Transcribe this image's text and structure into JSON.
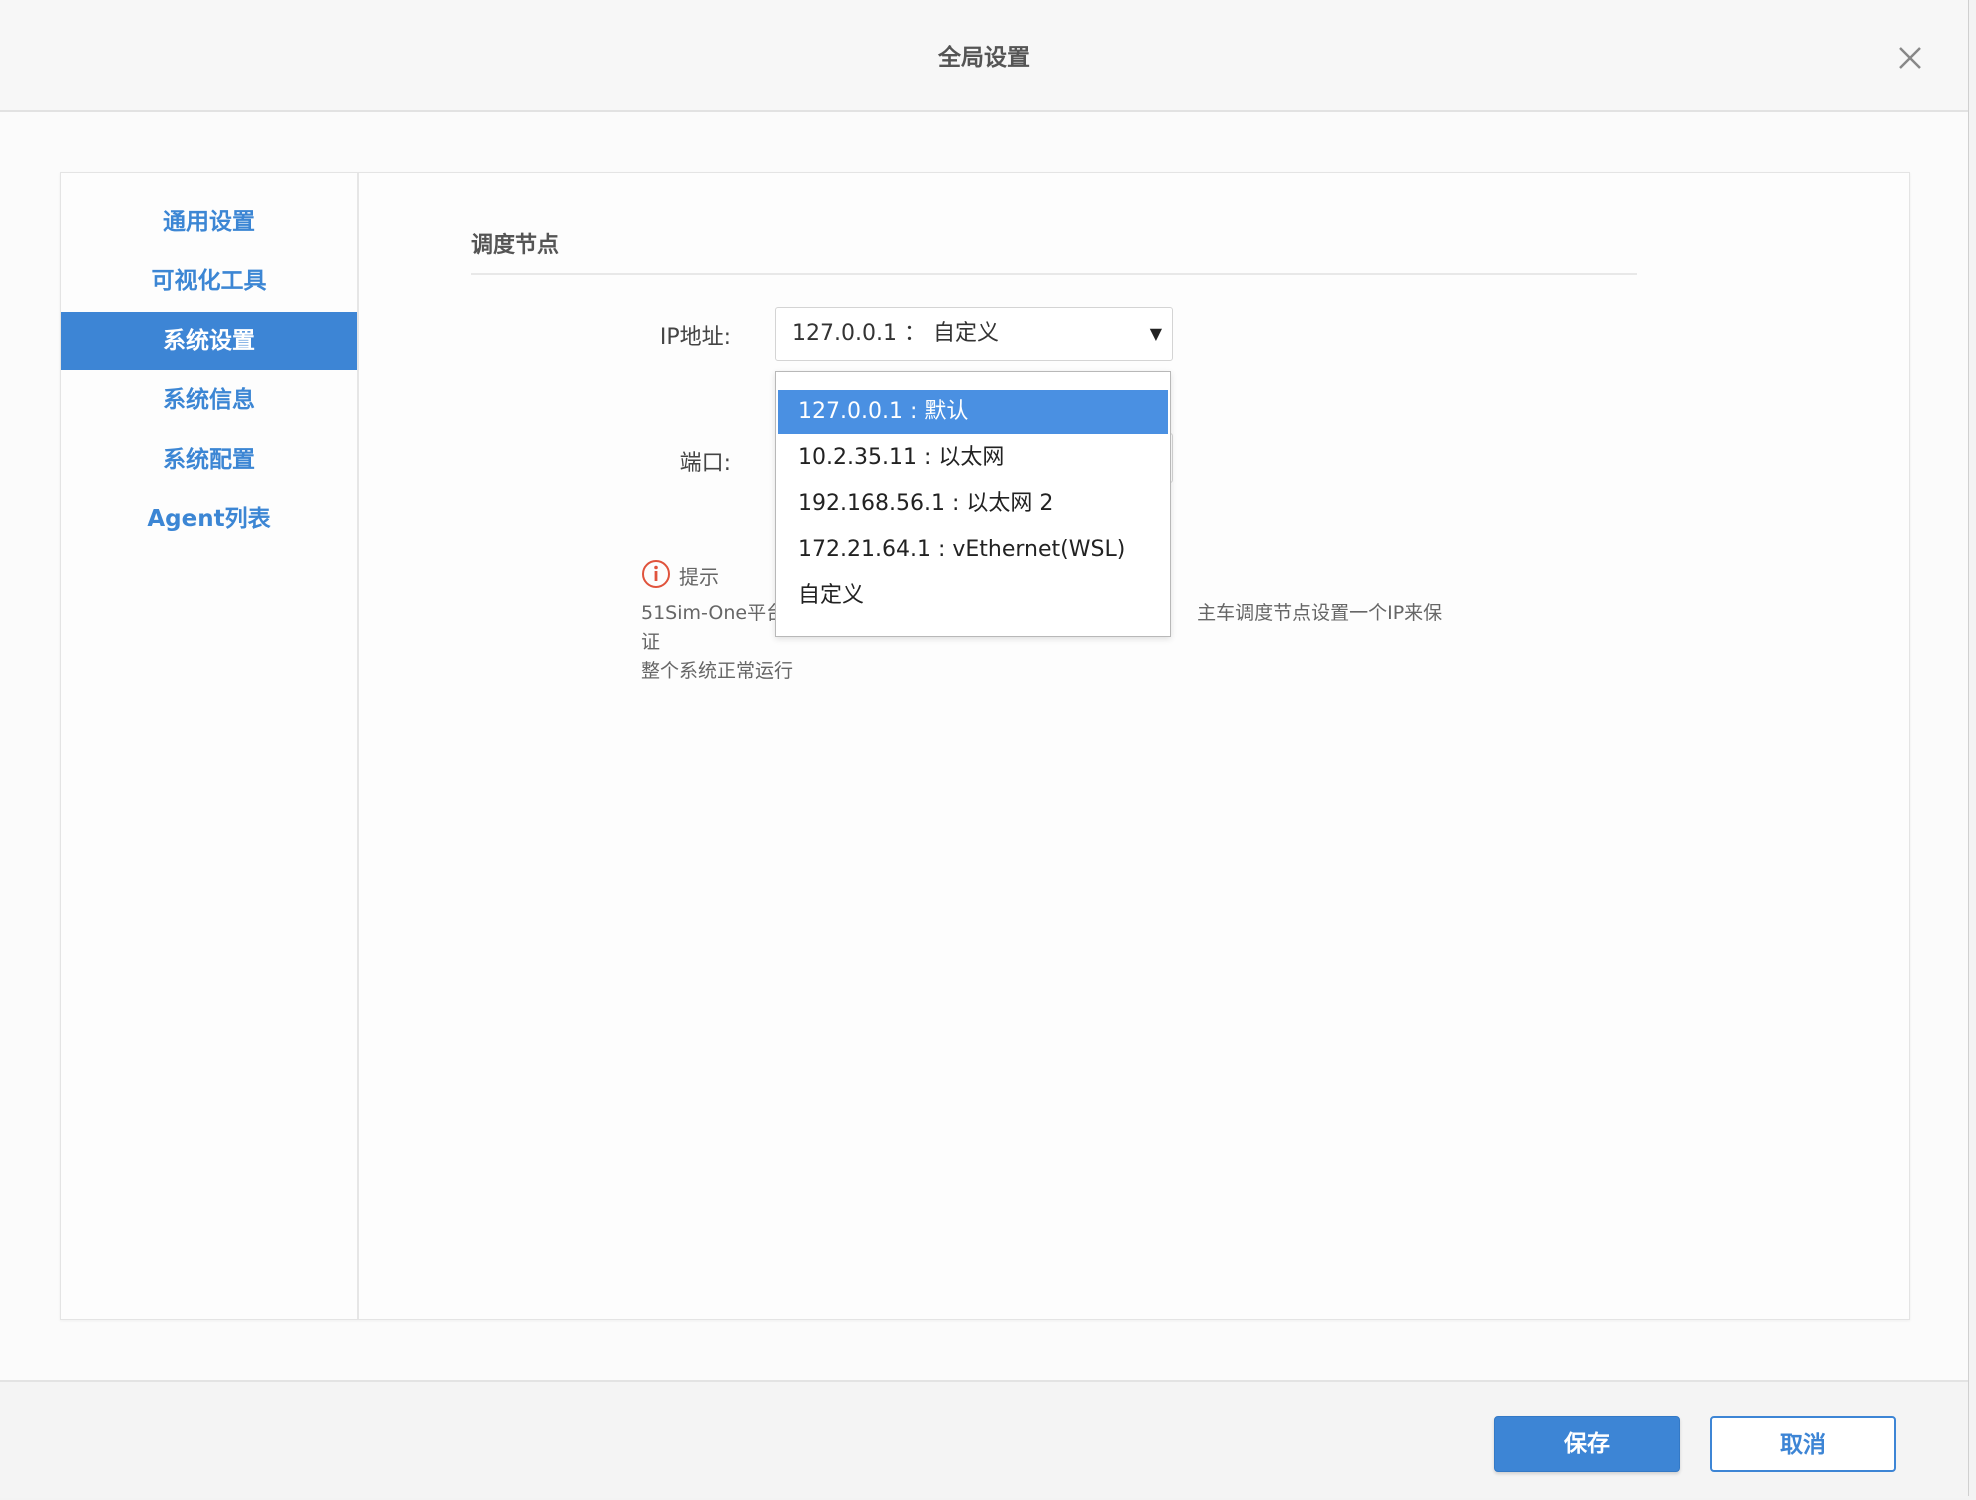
{
  "dialog": {
    "title": "全局设置"
  },
  "sidebar": {
    "items": [
      {
        "label": "通用设置",
        "active": false
      },
      {
        "label": "可视化工具",
        "active": false
      },
      {
        "label": "系统设置",
        "active": true
      },
      {
        "label": "系统信息",
        "active": false
      },
      {
        "label": "系统配置",
        "active": false
      },
      {
        "label": "Agent列表",
        "active": false
      }
    ]
  },
  "main": {
    "section_title": "调度节点",
    "ip_label": "IP地址:",
    "ip_value": "127.0.0.1 ： 自定义",
    "port_label": "端口:",
    "hint_title": "提示",
    "hint_line1": "51Sim-One平台",
    "hint_line1_end": "主车调度节点设置一个IP来保证",
    "hint_line2": "整个系统正常运行"
  },
  "dropdown": {
    "options": [
      "127.0.0.1 : 默认",
      "10.2.35.11 : 以太网",
      "192.168.56.1 : 以太网 2",
      "172.21.64.1 : vEthernet(WSL)",
      "自定义"
    ],
    "selected_index": 0
  },
  "footer": {
    "save_label": "保存",
    "cancel_label": "取消"
  },
  "colors": {
    "accent": "#3d85d5",
    "hint_icon": "#e0533c"
  }
}
